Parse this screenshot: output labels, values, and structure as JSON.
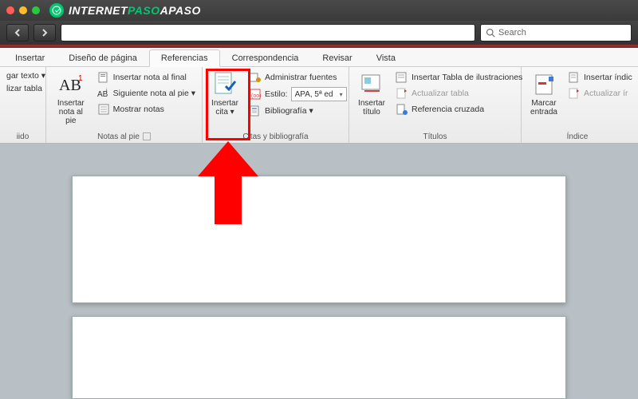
{
  "site": {
    "brand_a": "INTERNET",
    "brand_b": "PASO",
    "brand_c": "APASO"
  },
  "search": {
    "placeholder": "Search"
  },
  "tabs": {
    "insertar": "Insertar",
    "diseno": "Diseño de página",
    "referencias": "Referencias",
    "correspondencia": "Correspondencia",
    "revisar": "Revisar",
    "vista": "Vista"
  },
  "ribbon": {
    "group_tdc": {
      "item1": "gar texto ▾",
      "item2": "lizar tabla",
      "label": "iido"
    },
    "group_notas": {
      "big": "Insertar\nnota al pie",
      "s1": "Insertar nota al final",
      "s2": "Siguiente nota al pie ▾",
      "s3": "Mostrar notas",
      "label": "Notas al pie"
    },
    "group_citas": {
      "big": "Insertar\ncita ▾",
      "s1": "Administrar fuentes",
      "s2_label": "Estilo:",
      "s2_value": "APA, 5ª ed",
      "s3": "Bibliografía ▾",
      "label": "Citas y bibliografía"
    },
    "group_titulos": {
      "big": "Insertar\ntítulo",
      "s1": "Insertar Tabla de ilustraciones",
      "s2": "Actualizar tabla",
      "s3": "Referencia cruzada",
      "label": "Títulos"
    },
    "group_indice": {
      "big": "Marcar\nentrada",
      "s1": "Insertar índic",
      "s2": "Actualizar ír",
      "label": "Índice"
    }
  }
}
